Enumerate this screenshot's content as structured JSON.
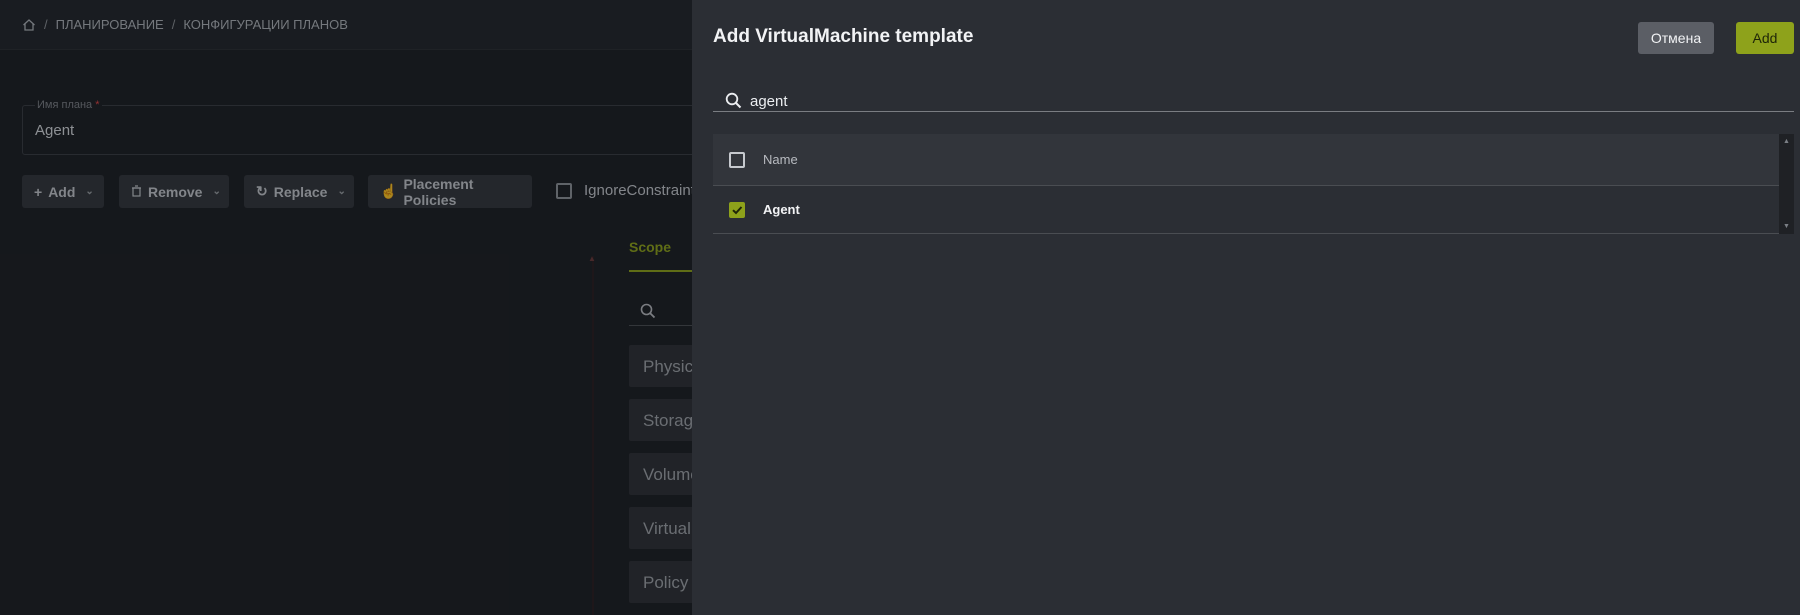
{
  "breadcrumb": {
    "items": [
      "ПЛАНИРОВАНИЕ",
      "КОНФИГУРАЦИИ ПЛАНОВ"
    ],
    "separator": "/"
  },
  "plan_name_field": {
    "label": "Имя плана",
    "required_mark": "*",
    "value": "Agent"
  },
  "toolbar": {
    "add_label": "Add",
    "remove_label": "Remove",
    "replace_label": "Replace",
    "placement_label": "Placement Policies",
    "ignore_label": "IgnoreConstraint"
  },
  "scope": {
    "tab_label": "Scope",
    "items": [
      "Physic",
      "Storag",
      "Volume",
      "VirtualI",
      "Policy"
    ]
  },
  "dialog": {
    "title": "Add VirtualMachine template",
    "cancel_label": "Отмена",
    "add_label": "Add",
    "search_value": "agent",
    "table": {
      "columns": [
        "Name"
      ],
      "rows": [
        {
          "name": "Agent",
          "checked": true
        }
      ]
    }
  },
  "colors": {
    "accent": "#8ea21b",
    "drawer_bg": "#2b2e34",
    "page_bg": "#1d1f24"
  }
}
